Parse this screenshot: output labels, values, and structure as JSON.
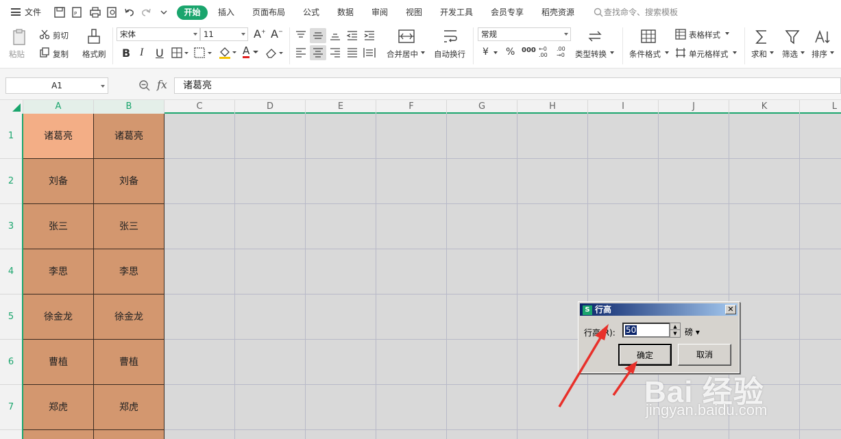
{
  "menu": {
    "file": "文件",
    "tabs": [
      "开始",
      "插入",
      "页面布局",
      "公式",
      "数据",
      "审阅",
      "视图",
      "开发工具",
      "会员专享",
      "稻壳资源"
    ],
    "search_placeholder": "查找命令、搜索模板"
  },
  "ribbon": {
    "paste": "粘贴",
    "cut": "剪切",
    "copy": "复制",
    "format_painter": "格式刷",
    "font_name": "宋体",
    "font_size": "11",
    "bold": "B",
    "italic": "I",
    "underline": "U",
    "font_color_letter": "A",
    "merge_center": "合并居中",
    "wrap_text": "自动换行",
    "number_format": "常规",
    "currency": "¥",
    "percent": "%",
    "thousands": "000",
    "inc_decimal": "←0 .00",
    "dec_decimal": ".00 →0",
    "type_convert": "类型转换",
    "conditional_format": "条件格式",
    "table_style": "表格样式",
    "cell_style": "单元格样式",
    "sum": "求和",
    "filter": "筛选",
    "sort": "排序"
  },
  "formula_bar": {
    "name_box": "A1",
    "fx": "fx",
    "content": "诸葛亮"
  },
  "grid": {
    "columns": [
      "A",
      "B",
      "C",
      "D",
      "E",
      "F",
      "G",
      "H",
      "I",
      "J",
      "K",
      "L"
    ],
    "rows": [
      "1",
      "2",
      "3",
      "4",
      "5",
      "6",
      "7"
    ],
    "col_a": [
      "诸葛亮",
      "刘备",
      "张三",
      "李思",
      "徐金龙",
      "曹植",
      "郑虎"
    ],
    "col_b": [
      "诸葛亮",
      "刘备",
      "张三",
      "李思",
      "徐金龙",
      "曹植",
      "郑虎"
    ]
  },
  "dialog": {
    "icon": "S",
    "title": "行高",
    "close": "✕",
    "label": "行高(R):",
    "value": "50",
    "unit": "磅",
    "ok": "确定",
    "cancel": "取消"
  },
  "watermark": {
    "main": "Bai 经验",
    "sub": "jingyan.baidu.com"
  },
  "colors": {
    "accent": "#1aa56d",
    "cell_fill": "#d3976f",
    "active_cell_fill": "#f3ae86",
    "grid_bg": "#d9d9d9",
    "arrow": "#e8302a"
  }
}
